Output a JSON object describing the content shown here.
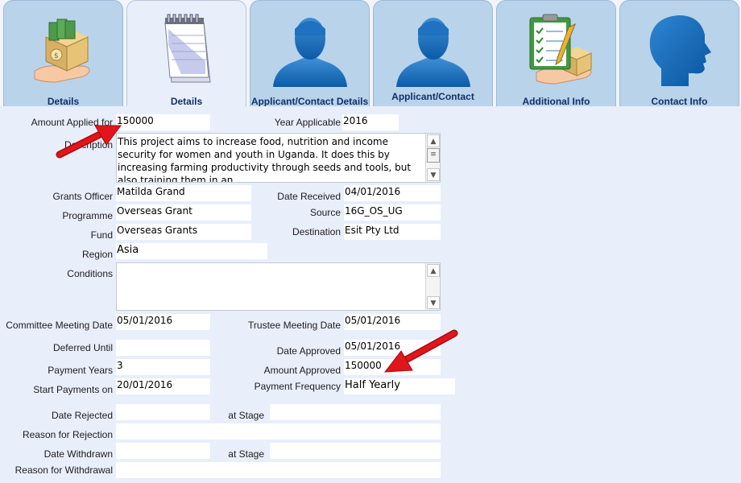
{
  "tabs": [
    {
      "label": "Details",
      "icon": "grant-box-hand-icon"
    },
    {
      "label": "Details",
      "icon": "notepad-icon"
    },
    {
      "label": "Applicant/Contact Details",
      "icon": "person-silhouette-icon"
    },
    {
      "label": "Applicant/Contact",
      "icon": "person-silhouette-icon"
    },
    {
      "label": "Additional Info",
      "icon": "clipboard-checklist-icon"
    },
    {
      "label": "Contact Info",
      "icon": "head-profile-icon"
    }
  ],
  "form": {
    "amount_applied_label": "Amount Applied for",
    "amount_applied": "150000",
    "year_applicable_label": "Year Applicable",
    "year_applicable": "2016",
    "description_label": "Description",
    "description": "This project aims to increase food, nutrition and income security for women and youth in Uganda. It does this by increasing farming productivity through seeds and tools, but also training them in an",
    "grants_officer_label": "Grants Officer",
    "grants_officer": "Matilda Grand",
    "date_received_label": "Date Received",
    "date_received": "04/01/2016",
    "programme_label": "Programme",
    "programme": "Overseas Grant",
    "source_label": "Source",
    "source": "16G_OS_UG",
    "fund_label": "Fund",
    "fund": "Overseas Grants",
    "destination_label": "Destination",
    "destination": "Esit Pty Ltd",
    "region_label": "Region",
    "region": "Asia",
    "conditions_label": "Conditions",
    "conditions": "",
    "committee_date_label": "Committee Meeting Date",
    "committee_date": "05/01/2016",
    "trustee_date_label": "Trustee Meeting Date",
    "trustee_date": "05/01/2016",
    "deferred_until_label": "Deferred Until",
    "deferred_until": "",
    "date_approved_label": "Date Approved",
    "date_approved": "05/01/2016",
    "payment_years_label": "Payment Years",
    "payment_years": "3",
    "amount_approved_label": "Amount Approved",
    "amount_approved": "150000",
    "start_payments_label": "Start Payments on",
    "start_payments": "20/01/2016",
    "payment_frequency_label": "Payment Frequency",
    "payment_frequency": "Half Yearly",
    "date_rejected_label": "Date Rejected",
    "date_rejected": "",
    "rejected_stage_label": "at Stage",
    "rejected_stage": "",
    "reason_rejection_label": "Reason for Rejection",
    "reason_rejection": "",
    "date_withdrawn_label": "Date Withdrawn",
    "date_withdrawn": "",
    "withdrawn_stage_label": "at Stage",
    "withdrawn_stage": "",
    "reason_withdrawal_label": "Reason for Withdrawal",
    "reason_withdrawal": ""
  },
  "colors": {
    "background": "#e9eefb",
    "tab": "#b9d3ea",
    "tab_label": "#12306a",
    "annotation_arrow": "#e0161b"
  },
  "annotations": [
    "red-arrow-amount-applied",
    "red-arrow-amount-approved"
  ]
}
